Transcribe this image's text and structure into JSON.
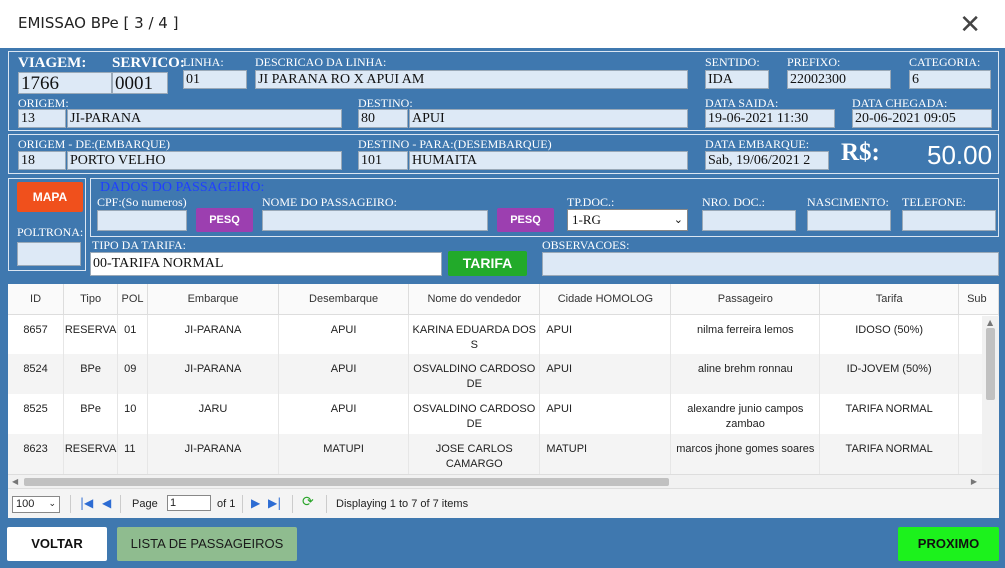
{
  "window": {
    "title": "EMISSAO BPe [ 3 / 4 ]",
    "close_icon": "close-icon"
  },
  "trip": {
    "viagem_label": "VIAGEM:",
    "viagem": "1766",
    "servico_label": "SERVICO:",
    "servico": "0001",
    "linha_label": "LINHA:",
    "linha": "01",
    "descricao_label": "DESCRICAO DA LINHA:",
    "descricao": "JI PARANA RO X APUI AM",
    "sentido_label": "SENTIDO:",
    "sentido": "IDA",
    "prefixo_label": "PREFIXO:",
    "prefixo": "22002300",
    "categoria_label": "CATEGORIA:",
    "categoria": "6",
    "origem_label": "ORIGEM:",
    "origem_code": "13",
    "origem_name": "JI-PARANA",
    "destino_label": "DESTINO:",
    "destino_code": "80",
    "destino_name": "APUI",
    "data_saida_label": "DATA SAIDA:",
    "data_saida": "19-06-2021 11:30",
    "data_chegada_label": "DATA CHEGADA:",
    "data_chegada": "20-06-2021 09:05"
  },
  "boarding": {
    "origem_de_label": "ORIGEM - DE:(EMBARQUE)",
    "origem_de_code": "18",
    "origem_de_name": "PORTO VELHO",
    "destino_para_label": "DESTINO - PARA:(DESEMBARQUE)",
    "destino_para_code": "101",
    "destino_para_name": "HUMAITA",
    "data_embarque_label": "DATA EMBARQUE:",
    "data_embarque": "Sab,  19/06/2021 2",
    "price_symbol": "R$:",
    "price": "50.00"
  },
  "passenger": {
    "mapa_label": "MAPA",
    "poltrona_label": "POLTRONA:",
    "poltrona": "",
    "section_title": "DADOS DO PASSAGEIRO:",
    "cpf_label": "CPF:(So numeros)",
    "cpf": "",
    "pesq_label": "PESQ",
    "nome_label": "NOME DO PASSAGEIRO:",
    "nome": "",
    "tpdoc_label": "TP.DOC.:",
    "tpdoc_value": "1-RG",
    "nrodoc_label": "NRO. DOC.:",
    "nrodoc": "",
    "nascimento_label": "NASCIMENTO:",
    "nascimento": "",
    "telefone_label": "TELEFONE:",
    "telefone": "",
    "tarifa_tipo_label": "TIPO DA TARIFA:",
    "tarifa_tipo": "00-TARIFA NORMAL",
    "tarifa_button": "TARIFA",
    "observacoes_label": "OBSERVACOES:",
    "observacoes": ""
  },
  "grid": {
    "columns": [
      "ID",
      "Tipo",
      "POL",
      "Embarque",
      "Desembarque",
      "Nome do vendedor",
      "Cidade HOMOLOG",
      "Passageiro",
      "Tarifa",
      "Sub"
    ],
    "rows": [
      [
        "8657",
        "RESERVA",
        "01",
        "JI-PARANA",
        "APUI",
        "KARINA EDUARDA DOS S",
        "APUI",
        "nilma ferreira lemos",
        "IDOSO (50%)",
        ""
      ],
      [
        "8524",
        "BPe",
        "09",
        "JI-PARANA",
        "APUI",
        "OSVALDINO CARDOSO DE",
        "APUI",
        "aline brehm ronnau",
        "ID-JOVEM (50%)",
        ""
      ],
      [
        "8525",
        "BPe",
        "10",
        "JARU",
        "APUI",
        "OSVALDINO CARDOSO DE",
        "APUI",
        "alexandre junio campos zambao",
        "TARIFA NORMAL",
        ""
      ],
      [
        "8623",
        "RESERVA",
        "11",
        "JI-PARANA",
        "MATUPI",
        "JOSE CARLOS CAMARGO",
        "MATUPI",
        "marcos jhone gomes soares",
        "TARIFA NORMAL",
        ""
      ]
    ]
  },
  "pager": {
    "page_size": "100",
    "page_label": "Page",
    "page": "1",
    "of_label": "of 1",
    "status": "Displaying 1 to 7 of 7 items"
  },
  "footer": {
    "voltar": "VOLTAR",
    "lista": "LISTA DE PASSAGEIROS",
    "proximo": "PROXIMO"
  },
  "colors": {
    "panel_blue": "#3f78af",
    "field_bg": "#dde9f6",
    "mapa_red": "#f0501c",
    "pesq_purple": "#9c3fb0",
    "tarifa_green": "#22aa2a",
    "proximo_green": "#1cf21c",
    "lista_green": "#8fbc8f"
  }
}
